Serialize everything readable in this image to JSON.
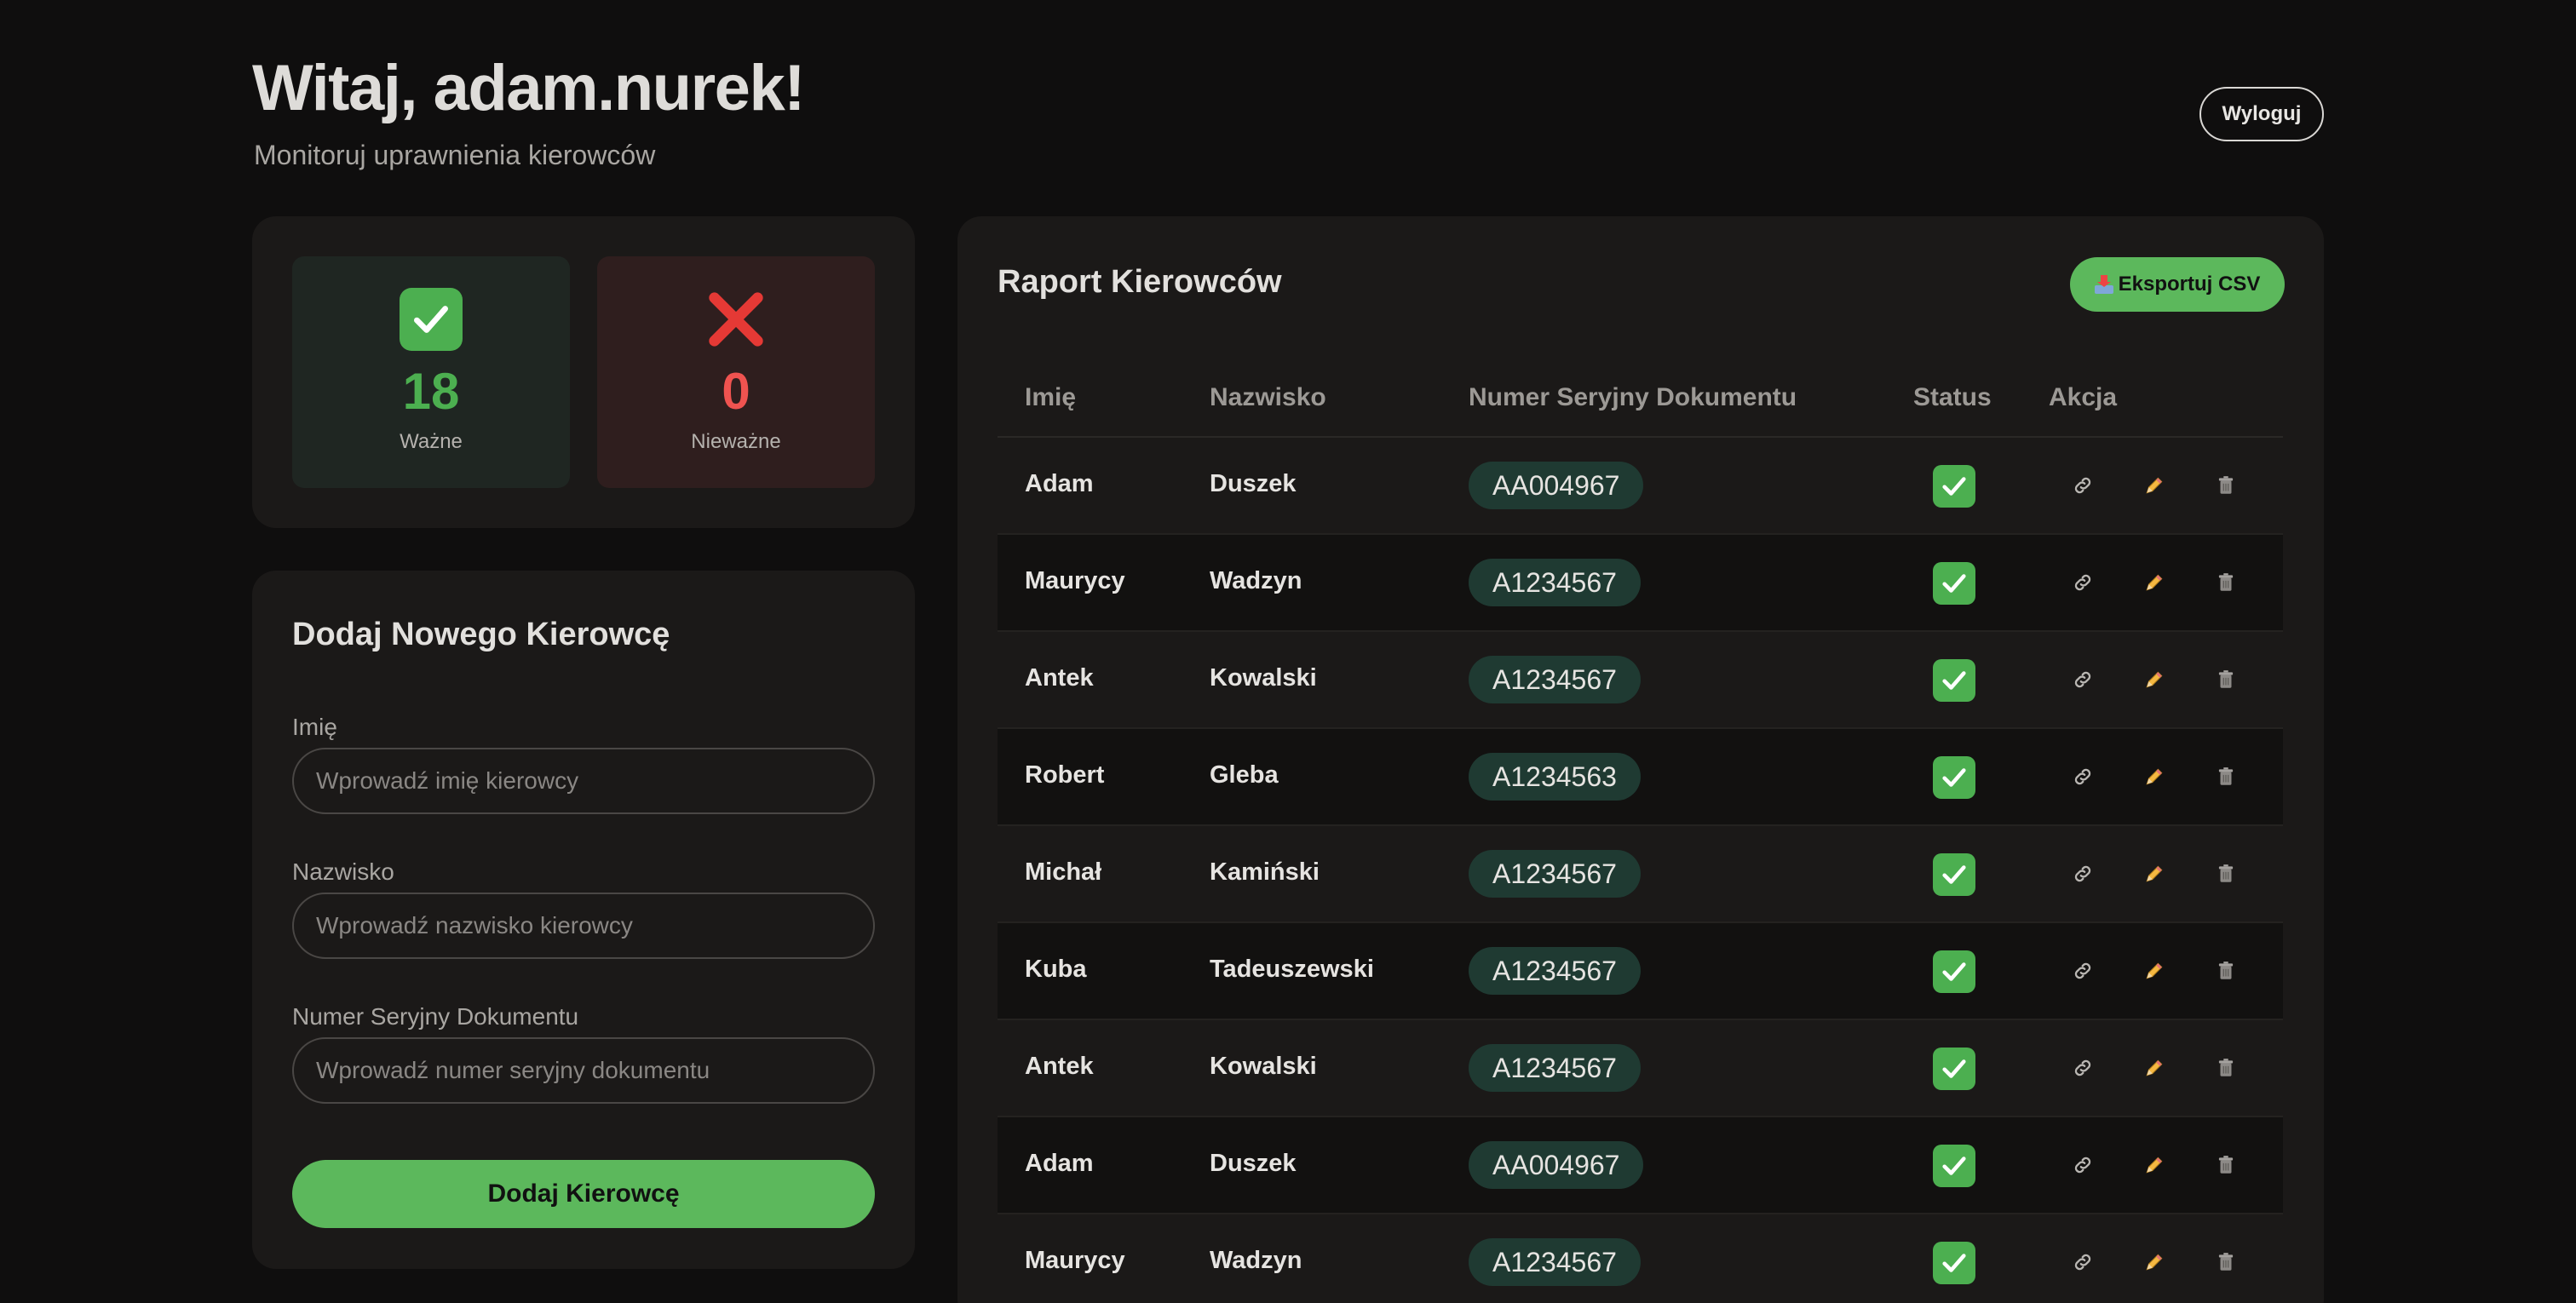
{
  "header": {
    "greeting": "Witaj, adam.nurek!",
    "subtitle": "Monitoruj uprawnienia kierowców",
    "logout_label": "Wyloguj"
  },
  "stats": {
    "valid": {
      "value": "18",
      "label": "Ważne",
      "icon": "check-mark-icon",
      "color": "#4caf50"
    },
    "invalid": {
      "value": "0",
      "label": "Nieważne",
      "icon": "cross-mark-icon",
      "color": "#ef5350"
    }
  },
  "form": {
    "title": "Dodaj Nowego Kierowcę",
    "first_name_label": "Imię",
    "first_name_placeholder": "Wprowadź imię kierowcy",
    "last_name_label": "Nazwisko",
    "last_name_placeholder": "Wprowadź nazwisko kierowcy",
    "serial_label": "Numer Seryjny Dokumentu",
    "serial_placeholder": "Wprowadź numer seryjny dokumentu",
    "submit_label": "Dodaj Kierowcę"
  },
  "report": {
    "title": "Raport Kierowców",
    "export_label": "Eksportuj CSV",
    "columns": [
      "Imię",
      "Nazwisko",
      "Numer Seryjny Dokumentu",
      "Status",
      "Akcja"
    ],
    "rows": [
      {
        "first": "Adam",
        "last": "Duszek",
        "serial": "AA004967",
        "status": "valid"
      },
      {
        "first": "Maurycy",
        "last": "Wadzyn",
        "serial": "A1234567",
        "status": "valid"
      },
      {
        "first": "Antek",
        "last": "Kowalski",
        "serial": "A1234567",
        "status": "valid"
      },
      {
        "first": "Robert",
        "last": "Gleba",
        "serial": "A1234563",
        "status": "valid"
      },
      {
        "first": "Michał",
        "last": "Kamiński",
        "serial": "A1234567",
        "status": "valid"
      },
      {
        "first": "Kuba",
        "last": "Tadeuszewski",
        "serial": "A1234567",
        "status": "valid"
      },
      {
        "first": "Antek",
        "last": "Kowalski",
        "serial": "A1234567",
        "status": "valid"
      },
      {
        "first": "Adam",
        "last": "Duszek",
        "serial": "AA004967",
        "status": "valid"
      },
      {
        "first": "Maurycy",
        "last": "Wadzyn",
        "serial": "A1234567",
        "status": "valid"
      }
    ]
  },
  "colors": {
    "accent": "#5cb85c",
    "background": "#0f0e0e",
    "card": "#1b1918",
    "serial_pill": "#1f3a32"
  }
}
